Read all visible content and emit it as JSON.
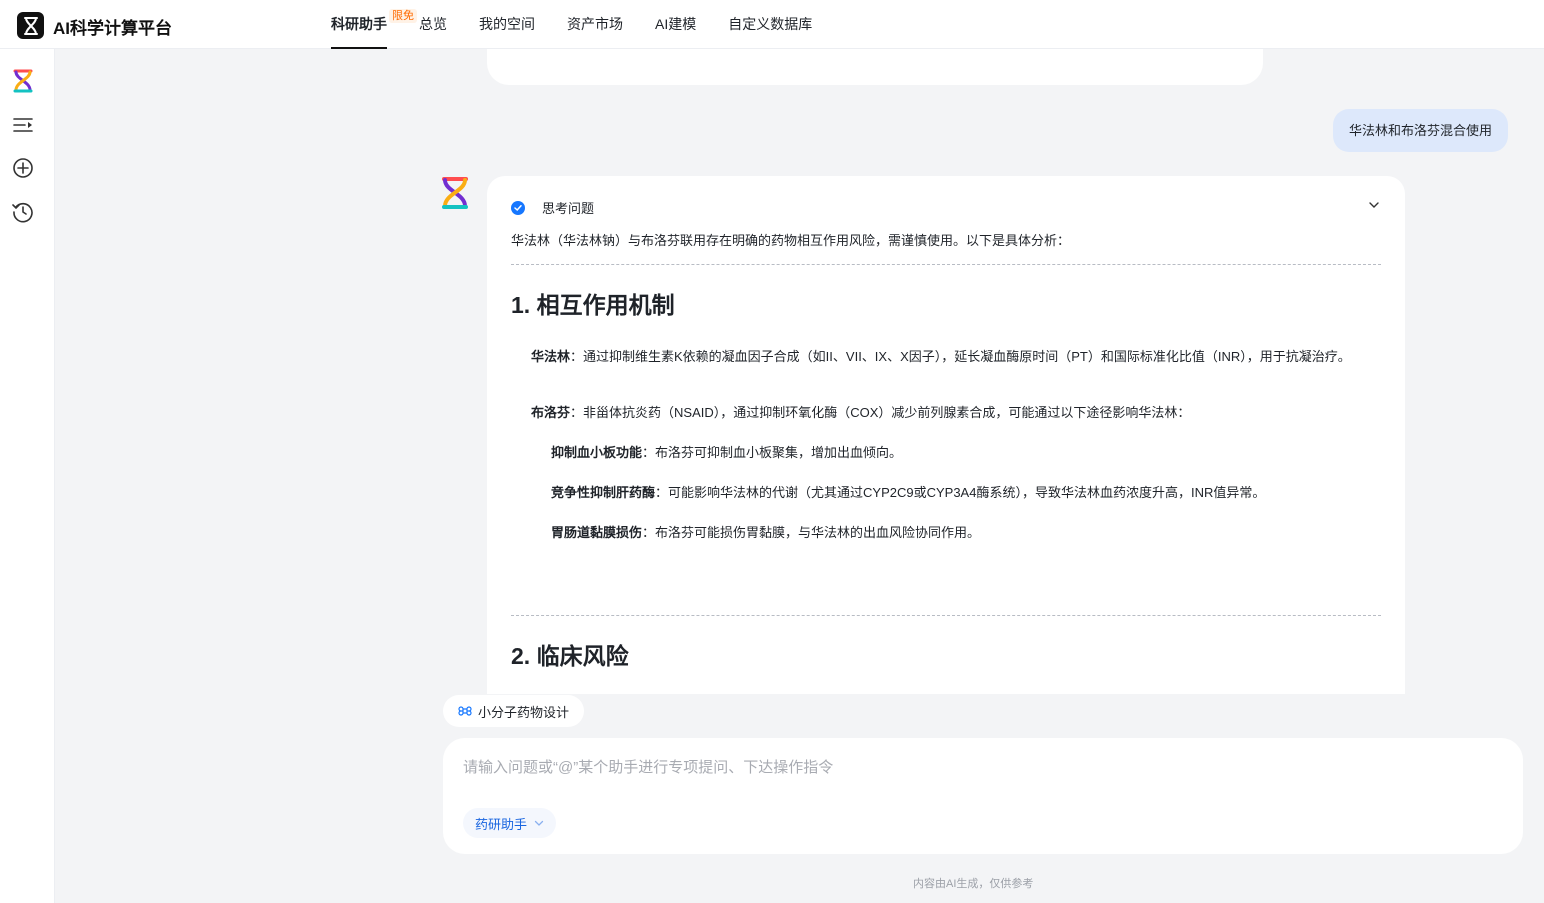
{
  "app": {
    "brand": "AI科学计算平台",
    "logo_icon": "hourglass-logo-icon"
  },
  "nav": {
    "items": [
      {
        "label": "科研助手",
        "active": true,
        "badge": "限免"
      },
      {
        "label": "总览"
      },
      {
        "label": "我的空间"
      },
      {
        "label": "资产市场"
      },
      {
        "label": "AI建模"
      },
      {
        "label": "自定义数据库"
      }
    ]
  },
  "sidebar": {
    "icons": [
      "colorful-logo-icon",
      "menu-collapse-icon",
      "new-chat-icon",
      "history-icon"
    ]
  },
  "chat": {
    "user_message": "华法林和布洛芬混合使用",
    "think_label": "思考问题",
    "intro": "华法林（华法林钠）与布洛芬联用存在明确的药物相互作用风险，需谨慎使用。以下是具体分析：",
    "section1": {
      "title": "1. 相互作用机制",
      "warfarin_term": "华法林",
      "warfarin_text": "：通过抑制维生素K依赖的凝血因子合成（如II、VII、IX、X因子），延长凝血酶原时间（PT）和国际标准化比值（INR），用于抗凝治疗。",
      "ibuprofen_term": "布洛芬",
      "ibuprofen_text": "：非甾体抗炎药（NSAID），通过抑制环氧化酶（COX）减少前列腺素合成，可能通过以下途径影响华法林：",
      "points": [
        {
          "term": "抑制血小板功能",
          "text": "：布洛芬可抑制血小板聚集，增加出血倾向。"
        },
        {
          "term": "竞争性抑制肝药酶",
          "text": "：可能影响华法林的代谢（尤其通过CYP2C9或CYP3A4酶系统），导致华法林血药浓度升高，INR值异常。"
        },
        {
          "term": "胃肠道黏膜损伤",
          "text": "：布洛芬可能损伤胃黏膜，与华法林的出血风险协同作用。"
        }
      ]
    },
    "section2": {
      "title": "2. 临床风险"
    }
  },
  "chip": {
    "label": "小分子药物设计"
  },
  "input": {
    "placeholder": "请输入问题或“@”某个助手进行专项提问、下达操作指令",
    "assistant_label": "药研助手"
  },
  "footnote": "内容由AI生成，仅供参考",
  "colors": {
    "accent": "#1677ff",
    "user_bubble": "#dde8fb",
    "badge": "#ff6a00"
  }
}
